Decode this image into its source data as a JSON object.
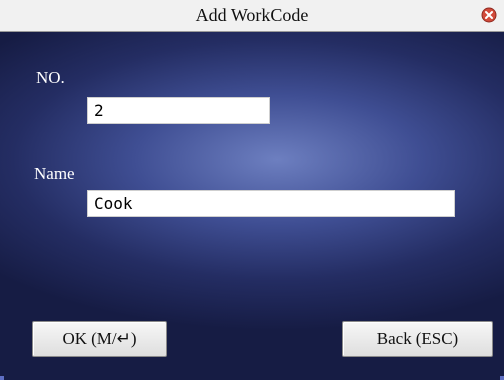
{
  "window": {
    "title": "Add WorkCode",
    "close_icon": "close-icon"
  },
  "form": {
    "no_label": "NO.",
    "no_value": "2",
    "name_label": "Name",
    "name_value": "Cook"
  },
  "buttons": {
    "ok_label": "OK",
    "ok_key": "(M/↵)",
    "back_label": "Back",
    "back_key": "(ESC)"
  },
  "colors": {
    "title_bar": "#f1f1f1",
    "background_center": "#6d7fc0",
    "background_edge": "#161c44",
    "close_icon": "#d24a3a"
  }
}
